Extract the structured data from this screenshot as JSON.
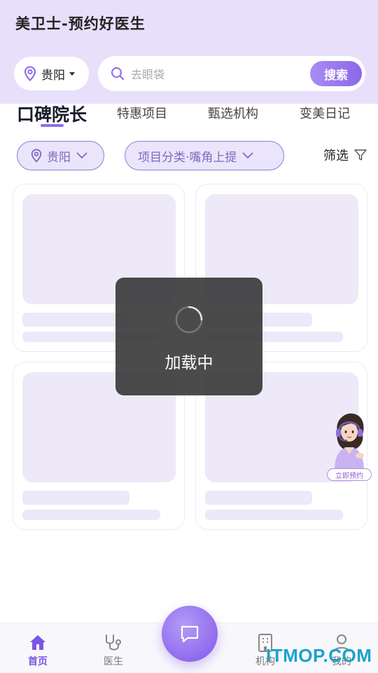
{
  "header": {
    "app_title": "美卫士-预约好医生",
    "city": "贵阳",
    "search_placeholder": "去眼袋",
    "search_button": "搜索"
  },
  "tabs": [
    {
      "label": "口碑院长",
      "active": true
    },
    {
      "label": "特惠项目",
      "active": false
    },
    {
      "label": "甄选机构",
      "active": false
    },
    {
      "label": "变美日记",
      "active": false
    }
  ],
  "filters": {
    "city_chip": "贵阳",
    "category_chip": "项目分类·嘴角上提",
    "filter_label": "筛选"
  },
  "loading": {
    "text": "加载中"
  },
  "assistant": {
    "button_label": "立即预约"
  },
  "tabbar": {
    "items": [
      {
        "label": "首页",
        "icon": "home-icon",
        "active": true
      },
      {
        "label": "医生",
        "icon": "stethoscope-icon",
        "active": false
      },
      {
        "label": "机构",
        "icon": "building-icon",
        "active": false
      },
      {
        "label": "我的",
        "icon": "user-icon",
        "active": false
      }
    ],
    "center_icon": "chat-icon"
  },
  "colors": {
    "accent": "#8c67ea",
    "header_bg": "#e8e0fb",
    "chip_bg": "#ebe5fb",
    "placeholder_bg": "#ede9f8"
  },
  "watermark": "ITMOP.COM"
}
